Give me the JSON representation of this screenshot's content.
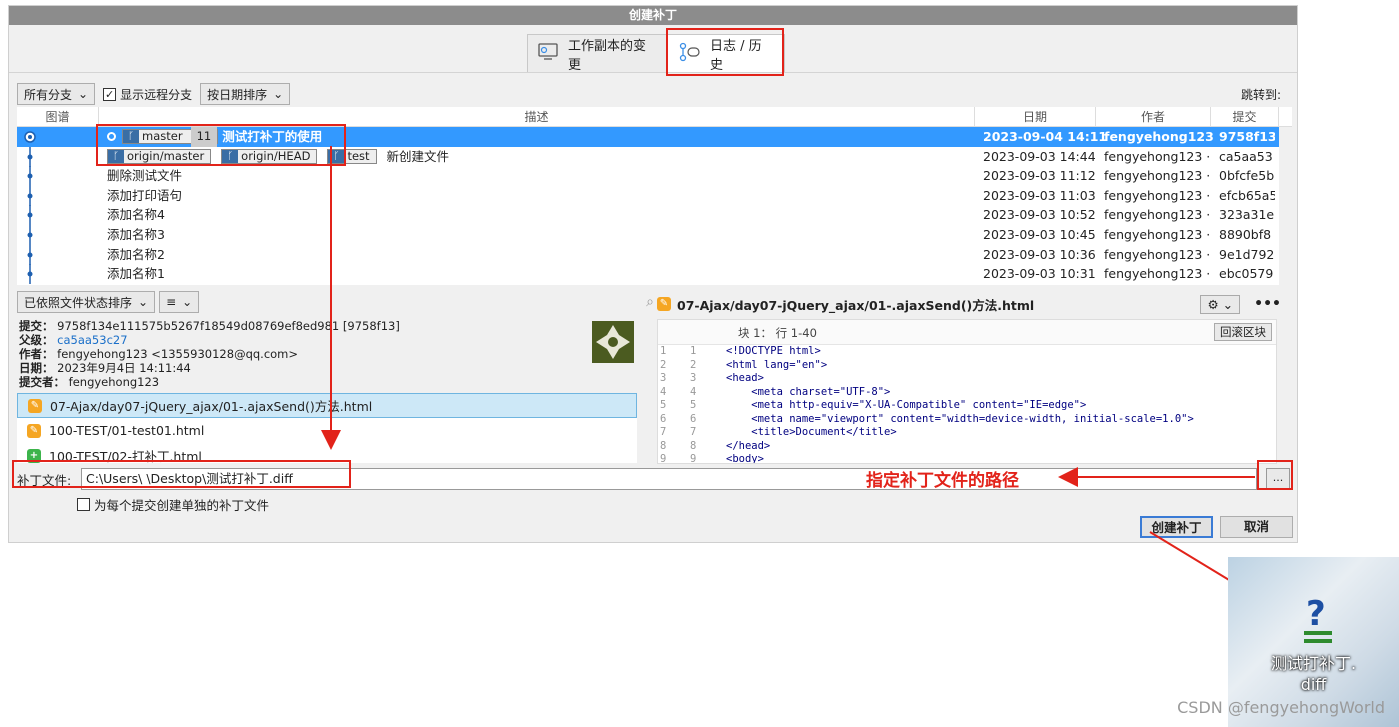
{
  "window": {
    "title": "创建补丁"
  },
  "tabs": [
    {
      "label": "工作副本的变更"
    },
    {
      "label": "日志 / 历史"
    }
  ],
  "toolbar": {
    "branch_filter": "所有分支",
    "show_remote_label": "显示远程分支",
    "sort": "按日期排序",
    "jump_label": "跳转到:"
  },
  "log_columns": {
    "graph": "图谱",
    "desc": "描述",
    "date": "日期",
    "author": "作者",
    "commit": "提交"
  },
  "log_rows": [
    {
      "desc": "测试打补丁的使用",
      "date": "2023-09-04 14:11",
      "author": "fengyehong123",
      "hash": "9758f13",
      "branch": "master",
      "count": "11"
    },
    {
      "desc": "新创建文件",
      "date": "2023-09-03 14:44",
      "author": "fengyehong123 ·",
      "hash": "ca5aa53",
      "b1": "origin/master",
      "b2": "origin/HEAD",
      "b3": "test"
    },
    {
      "desc": "删除测试文件",
      "date": "2023-09-03 11:12",
      "author": "fengyehong123 ·",
      "hash": "0bfcfe5b"
    },
    {
      "desc": "添加打印语句",
      "date": "2023-09-03 11:03",
      "author": "fengyehong123 ·",
      "hash": "efcb65a5"
    },
    {
      "desc": "添加名称4",
      "date": "2023-09-03 10:52",
      "author": "fengyehong123 ·",
      "hash": "323a31e"
    },
    {
      "desc": "添加名称3",
      "date": "2023-09-03 10:45",
      "author": "fengyehong123 ·",
      "hash": "8890bf8"
    },
    {
      "desc": "添加名称2",
      "date": "2023-09-03 10:36",
      "author": "fengyehong123 ·",
      "hash": "9e1d792"
    },
    {
      "desc": "添加名称1",
      "date": "2023-09-03 10:31",
      "author": "fengyehong123 ·",
      "hash": "ebc0579"
    }
  ],
  "lower_toolbar": {
    "sort": "已依照文件状态排序",
    "view": "≡"
  },
  "commit_info": {
    "commit_label": "提交：",
    "commit_value": "9758f134e111575b5267f18549d08769ef8ed981 [9758f13]",
    "parent_label": "父级：",
    "parent_value": "ca5aa53c27",
    "author_label": "作者：",
    "author_value": "fengyehong123 <1355930128@qq.com>",
    "date_label": "日期：",
    "date_value": "2023年9月4日 14:11:44",
    "committer_label": "提交者：",
    "committer_value": "fengyehong123"
  },
  "files": [
    {
      "name": "07-Ajax/day07-jQuery_ajax/01-.ajaxSend()方法.html",
      "status": "modified"
    },
    {
      "name": "100-TEST/01-test01.html",
      "status": "modified"
    },
    {
      "name": "100-TEST/02-打补丁.html",
      "status": "added"
    }
  ],
  "diff": {
    "file": "07-Ajax/day07-jQuery_ajax/01-.ajaxSend()方法.html",
    "hunk": "块 1： 行 1-40",
    "revert": "回滚区块",
    "lines": [
      {
        "a": "1",
        "b": "1",
        "code": "<!DOCTYPE html>"
      },
      {
        "a": "2",
        "b": "2",
        "code": "<html lang=\"en\">"
      },
      {
        "a": "3",
        "b": "3",
        "code": "<head>"
      },
      {
        "a": "4",
        "b": "4",
        "code": "    <meta charset=\"UTF-8\">"
      },
      {
        "a": "5",
        "b": "5",
        "code": "    <meta http-equiv=\"X-UA-Compatible\" content=\"IE=edge\">"
      },
      {
        "a": "6",
        "b": "6",
        "code": "    <meta name=\"viewport\" content=\"width=device-width, initial-scale=1.0\">"
      },
      {
        "a": "7",
        "b": "7",
        "code": "    <title>Document</title>"
      },
      {
        "a": "8",
        "b": "8",
        "code": "</head>"
      },
      {
        "a": "9",
        "b": "9",
        "code": "<body>"
      }
    ]
  },
  "patch": {
    "label": "补丁文件:",
    "path": "C:\\Users\\      \\Desktop\\测试打补丁.diff",
    "browse": "...",
    "separate_label": "为每个提交创建单独的补丁文件"
  },
  "buttons": {
    "create": "创建补丁",
    "cancel": "取消"
  },
  "annotation": "指定补丁文件的路径",
  "desktop_icon": {
    "line1": "测试打补丁.",
    "line2": "diff"
  },
  "watermark": "CSDN @fengyehongWorld",
  "colors": {
    "accent": "#3399ff",
    "annotation": "#e2231a",
    "titlebar": "#8c8c8c"
  }
}
